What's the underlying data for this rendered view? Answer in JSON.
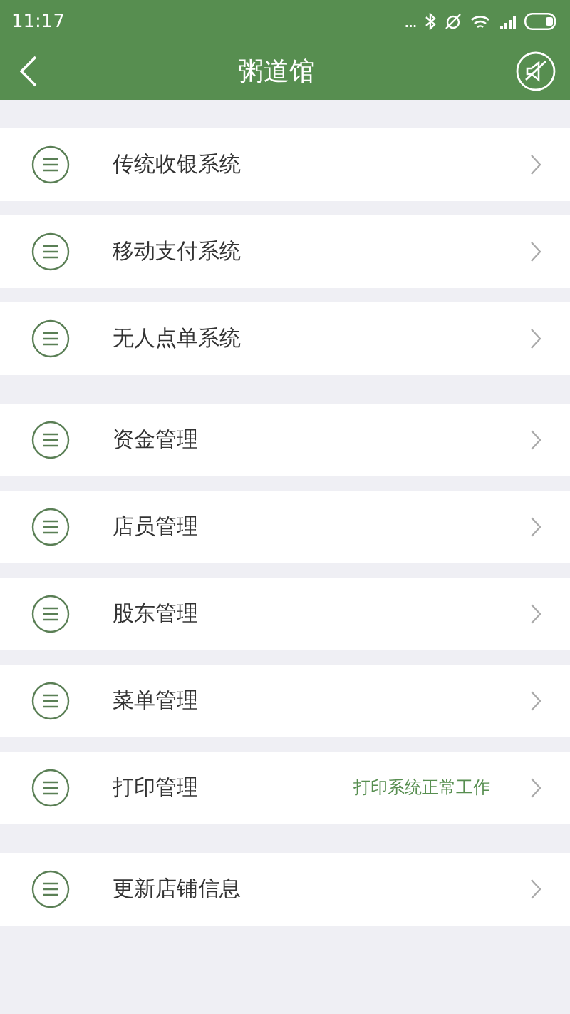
{
  "status_bar": {
    "time": "11:17",
    "dots": "..."
  },
  "header": {
    "title": "粥道馆"
  },
  "groups": [
    {
      "items": [
        {
          "label": "传统收银系统"
        },
        {
          "label": "移动支付系统"
        },
        {
          "label": "无人点单系统"
        }
      ]
    },
    {
      "items": [
        {
          "label": "资金管理"
        },
        {
          "label": "店员管理"
        },
        {
          "label": "股东管理"
        },
        {
          "label": "菜单管理"
        },
        {
          "label": "打印管理",
          "status": "打印系统正常工作"
        }
      ]
    },
    {
      "items": [
        {
          "label": "更新店铺信息"
        }
      ]
    }
  ]
}
